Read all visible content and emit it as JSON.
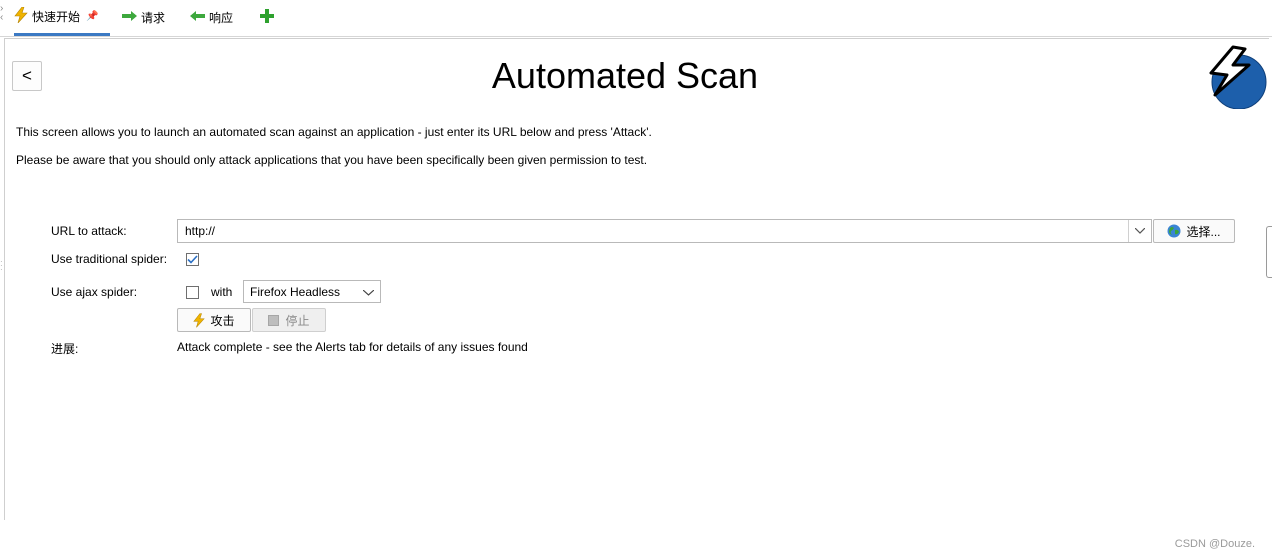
{
  "tabs": [
    {
      "label": "快速开始",
      "icon": "lightning-icon",
      "pin_icon": "pin-icon",
      "active": true
    },
    {
      "label": "请求",
      "icon": "arrow-right-icon"
    },
    {
      "label": "响应",
      "icon": "arrow-left-icon"
    },
    {
      "label": "",
      "icon": "plus-icon"
    }
  ],
  "header": {
    "back_label": "<",
    "title": "Automated Scan",
    "logo_icon": "zap-logo-icon"
  },
  "description": {
    "line1": "This screen allows you to launch an automated scan against  an application - just enter its URL below and press 'Attack'.",
    "line2": "Please be aware that you should only attack applications that you have been specifically been given permission to test."
  },
  "form": {
    "url_label": "URL to attack:",
    "url_value": "http://",
    "select_button": "选择...",
    "traditional_label": "Use traditional spider:",
    "traditional_checked": true,
    "ajax_label": "Use ajax spider:",
    "ajax_checked": false,
    "with_label": "with",
    "browser_value": "Firefox Headless",
    "attack_button": "攻击",
    "stop_button": "停止",
    "progress_label": "进展:",
    "progress_value": "Attack complete - see the Alerts tab for details of any issues found"
  },
  "watermark": "CSDN @Douze.",
  "colors": {
    "accent": "#3b79c3",
    "lightning": "#f0b400",
    "green": "#2ea12e",
    "logo_blue": "#1d5fab"
  }
}
